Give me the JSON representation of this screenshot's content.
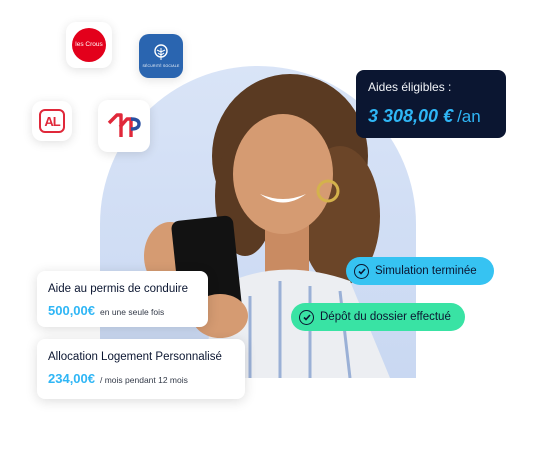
{
  "logos": {
    "crous": {
      "text": "les Crous",
      "color": "#e3001b"
    },
    "caf": {
      "text": "SÉCURITÉ SOCIALE",
      "color": "#2a65b0"
    },
    "al": {
      "text": "AL",
      "color": "#e0283a"
    },
    "pp": {
      "colors": [
        "#e0283a",
        "#2a4fa0"
      ]
    }
  },
  "aides": {
    "label": "Aides éligibles :",
    "amount": "3 308,00 €",
    "unit": "/an"
  },
  "status": {
    "simulation": "Simulation terminée",
    "depot": "Dépôt du dossier effectué"
  },
  "cards": [
    {
      "title": "Aide au permis de conduire",
      "amount": "500,00€",
      "note": "en une seule fois"
    },
    {
      "title": "Allocation Logement Personnalisé",
      "amount": "234,00€",
      "note": "/ mois pendant 12 mois"
    }
  ],
  "colors": {
    "navy": "#0b1631",
    "accent_blue": "#2fb6f5",
    "pill_blue": "#36c3f2",
    "pill_green": "#39e3a4"
  }
}
